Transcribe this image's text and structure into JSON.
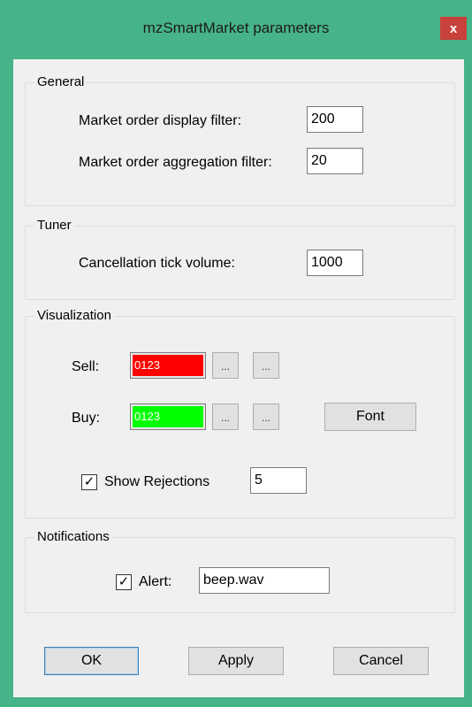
{
  "window": {
    "title": "mzSmartMarket parameters",
    "close_glyph": "x",
    "accent_color": "#47b389",
    "close_color": "#c8413b"
  },
  "general": {
    "legend": "General",
    "display_filter_label": "Market order display filter:",
    "display_filter_value": "200",
    "aggregation_filter_label": "Market order aggregation filter:",
    "aggregation_filter_value": "20"
  },
  "tuner": {
    "legend": "Tuner",
    "cancellation_label": "Cancellation tick volume:",
    "cancellation_value": "1000"
  },
  "visualization": {
    "legend": "Visualization",
    "sell_label": "Sell:",
    "sell_sample": "0123",
    "sell_color": "#ff0000",
    "buy_label": "Buy:",
    "buy_sample": "0123",
    "buy_color": "#00ff00",
    "ellipsis": "...",
    "font_button": "Font",
    "show_rejections_label": "Show Rejections",
    "show_rejections_checked": true,
    "rejections_value": "5"
  },
  "notifications": {
    "legend": "Notifications",
    "alert_label": "Alert:",
    "alert_checked": true,
    "alert_file": "beep.wav"
  },
  "buttons": {
    "ok": "OK",
    "apply": "Apply",
    "cancel": "Cancel"
  },
  "check_glyph": "✓"
}
